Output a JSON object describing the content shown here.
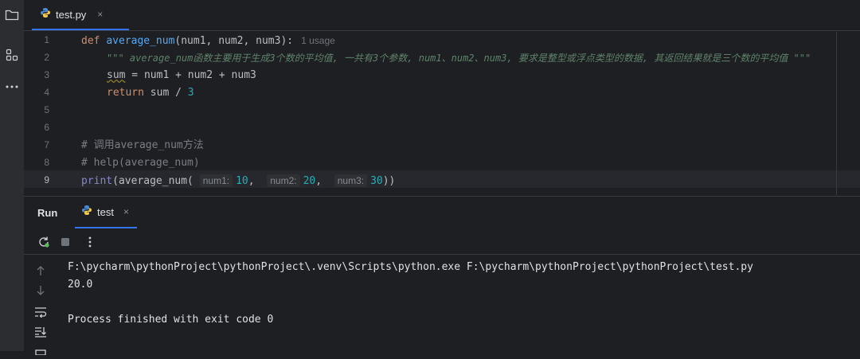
{
  "editor": {
    "tab": {
      "label": "test.py",
      "close": "×"
    },
    "line_numbers": [
      "1",
      "2",
      "3",
      "4",
      "5",
      "6",
      "7",
      "8",
      "9"
    ],
    "current_line": "9",
    "code": {
      "l1_def": "def",
      "l1_name": "average_num",
      "l1_params": "(num1, num2, num3):",
      "l1_usage": "1 usage",
      "l2_doc": "\"\"\" average_num函数主要用于生成3个数的平均值, 一共有3个参数, num1、num2、num3, 要求是整型或浮点类型的数据, 其返回结果就是三个数的平均值 \"\"\"",
      "l3_sum": "sum",
      "l3_rest": " = num1 + num2 + num3",
      "l4_return": "return",
      "l4_rest": " sum / ",
      "l4_num": "3",
      "l7_comment": "# 调用average_num方法",
      "l8_comment": "# help(average_num)",
      "l9_print": "print",
      "l9_open": "(average_num( ",
      "l9_hint1": "num1:",
      "l9_v1": "10",
      "l9_sep1": ",  ",
      "l9_hint2": "num2:",
      "l9_v2": "20",
      "l9_sep2": ",  ",
      "l9_hint3": "num3:",
      "l9_v3": "30",
      "l9_close": "))"
    }
  },
  "run_panel": {
    "title": "Run",
    "tab": {
      "label": "test",
      "close": "×"
    },
    "output": [
      "F:\\pycharm\\pythonProject\\pythonProject\\.venv\\Scripts\\python.exe F:\\pycharm\\pythonProject\\pythonProject\\test.py",
      "20.0",
      "",
      "Process finished with exit code 0"
    ]
  },
  "icons": {
    "project": "folder-icon",
    "structure": "structure-icon",
    "more": "more-icon",
    "rerun": "rerun-icon",
    "stop": "stop-icon",
    "options": "options-icon",
    "up": "arrow-up-icon",
    "down": "arrow-down-icon",
    "wrap": "soft-wrap-icon",
    "scroll": "scroll-to-end-icon"
  },
  "colors": {
    "accent": "#3574f0",
    "keyword": "#cf8e6d",
    "function": "#56a8f5",
    "number": "#2aacb8",
    "docstring": "#5f826b",
    "background": "#1e1f22"
  }
}
